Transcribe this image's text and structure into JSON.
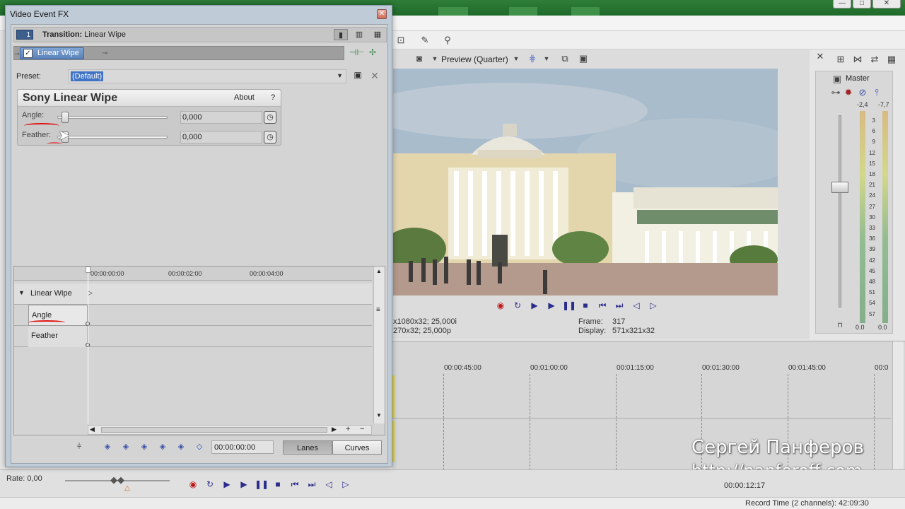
{
  "dialog": {
    "title": "Video Event FX",
    "chain_number": "1",
    "transition_prefix": "Transition:",
    "transition_name": "Linear Wipe",
    "plugin_chip": "Linear Wipe",
    "preset_label": "Preset:",
    "preset_value": "(Default)",
    "plugin_name": "Sony Linear Wipe",
    "about_label": "About",
    "help_label": "?",
    "params": [
      {
        "label": "Angle:",
        "value": "0,000"
      },
      {
        "label": "Feather:",
        "value": "0,000"
      }
    ],
    "keyframes": {
      "ruler": [
        "00:00:00:00",
        "00:00:02:00",
        "00:00:04:00"
      ],
      "group_label": "Linear Wipe",
      "tracks": [
        "Angle",
        "Feather"
      ],
      "time_value": "00:00:00:00",
      "lanes_label": "Lanes",
      "curves_label": "Curves"
    }
  },
  "preview": {
    "quality_label": "Preview (Quarter)",
    "project_line": "x1080x32; 25,000i",
    "preview_line": "270x32; 25,000p",
    "frame_label": "Frame:",
    "frame_value": "317",
    "display_label": "Display:",
    "display_value": "571x321x32"
  },
  "mixer": {
    "title": "Master",
    "peak_left": "-2,4",
    "peak_right": "-7,7",
    "scale": [
      "3",
      "6",
      "9",
      "12",
      "15",
      "18",
      "21",
      "24",
      "27",
      "30",
      "33",
      "36",
      "39",
      "42",
      "45",
      "48",
      "51",
      "54",
      "57"
    ],
    "level_left": "0.0",
    "level_right": "0.0"
  },
  "timeline": {
    "ruler": [
      "00:00:45:00",
      "00:01:00:00",
      "00:01:15:00",
      "00:01:30:00",
      "00:01:45:00",
      "00:0"
    ]
  },
  "watermark": {
    "name": "Сергей Панферов",
    "url": "http://panferoff.com"
  },
  "bottom": {
    "rate_label": "Rate: 0,00",
    "time_value": "00:00:12:17",
    "record_time": "Record Time (2 channels): 42:09:30"
  },
  "colors": {
    "accent_blue": "#3f73c6",
    "annotation_red": "#e01010",
    "titlebar_green": "#2e7d38"
  }
}
